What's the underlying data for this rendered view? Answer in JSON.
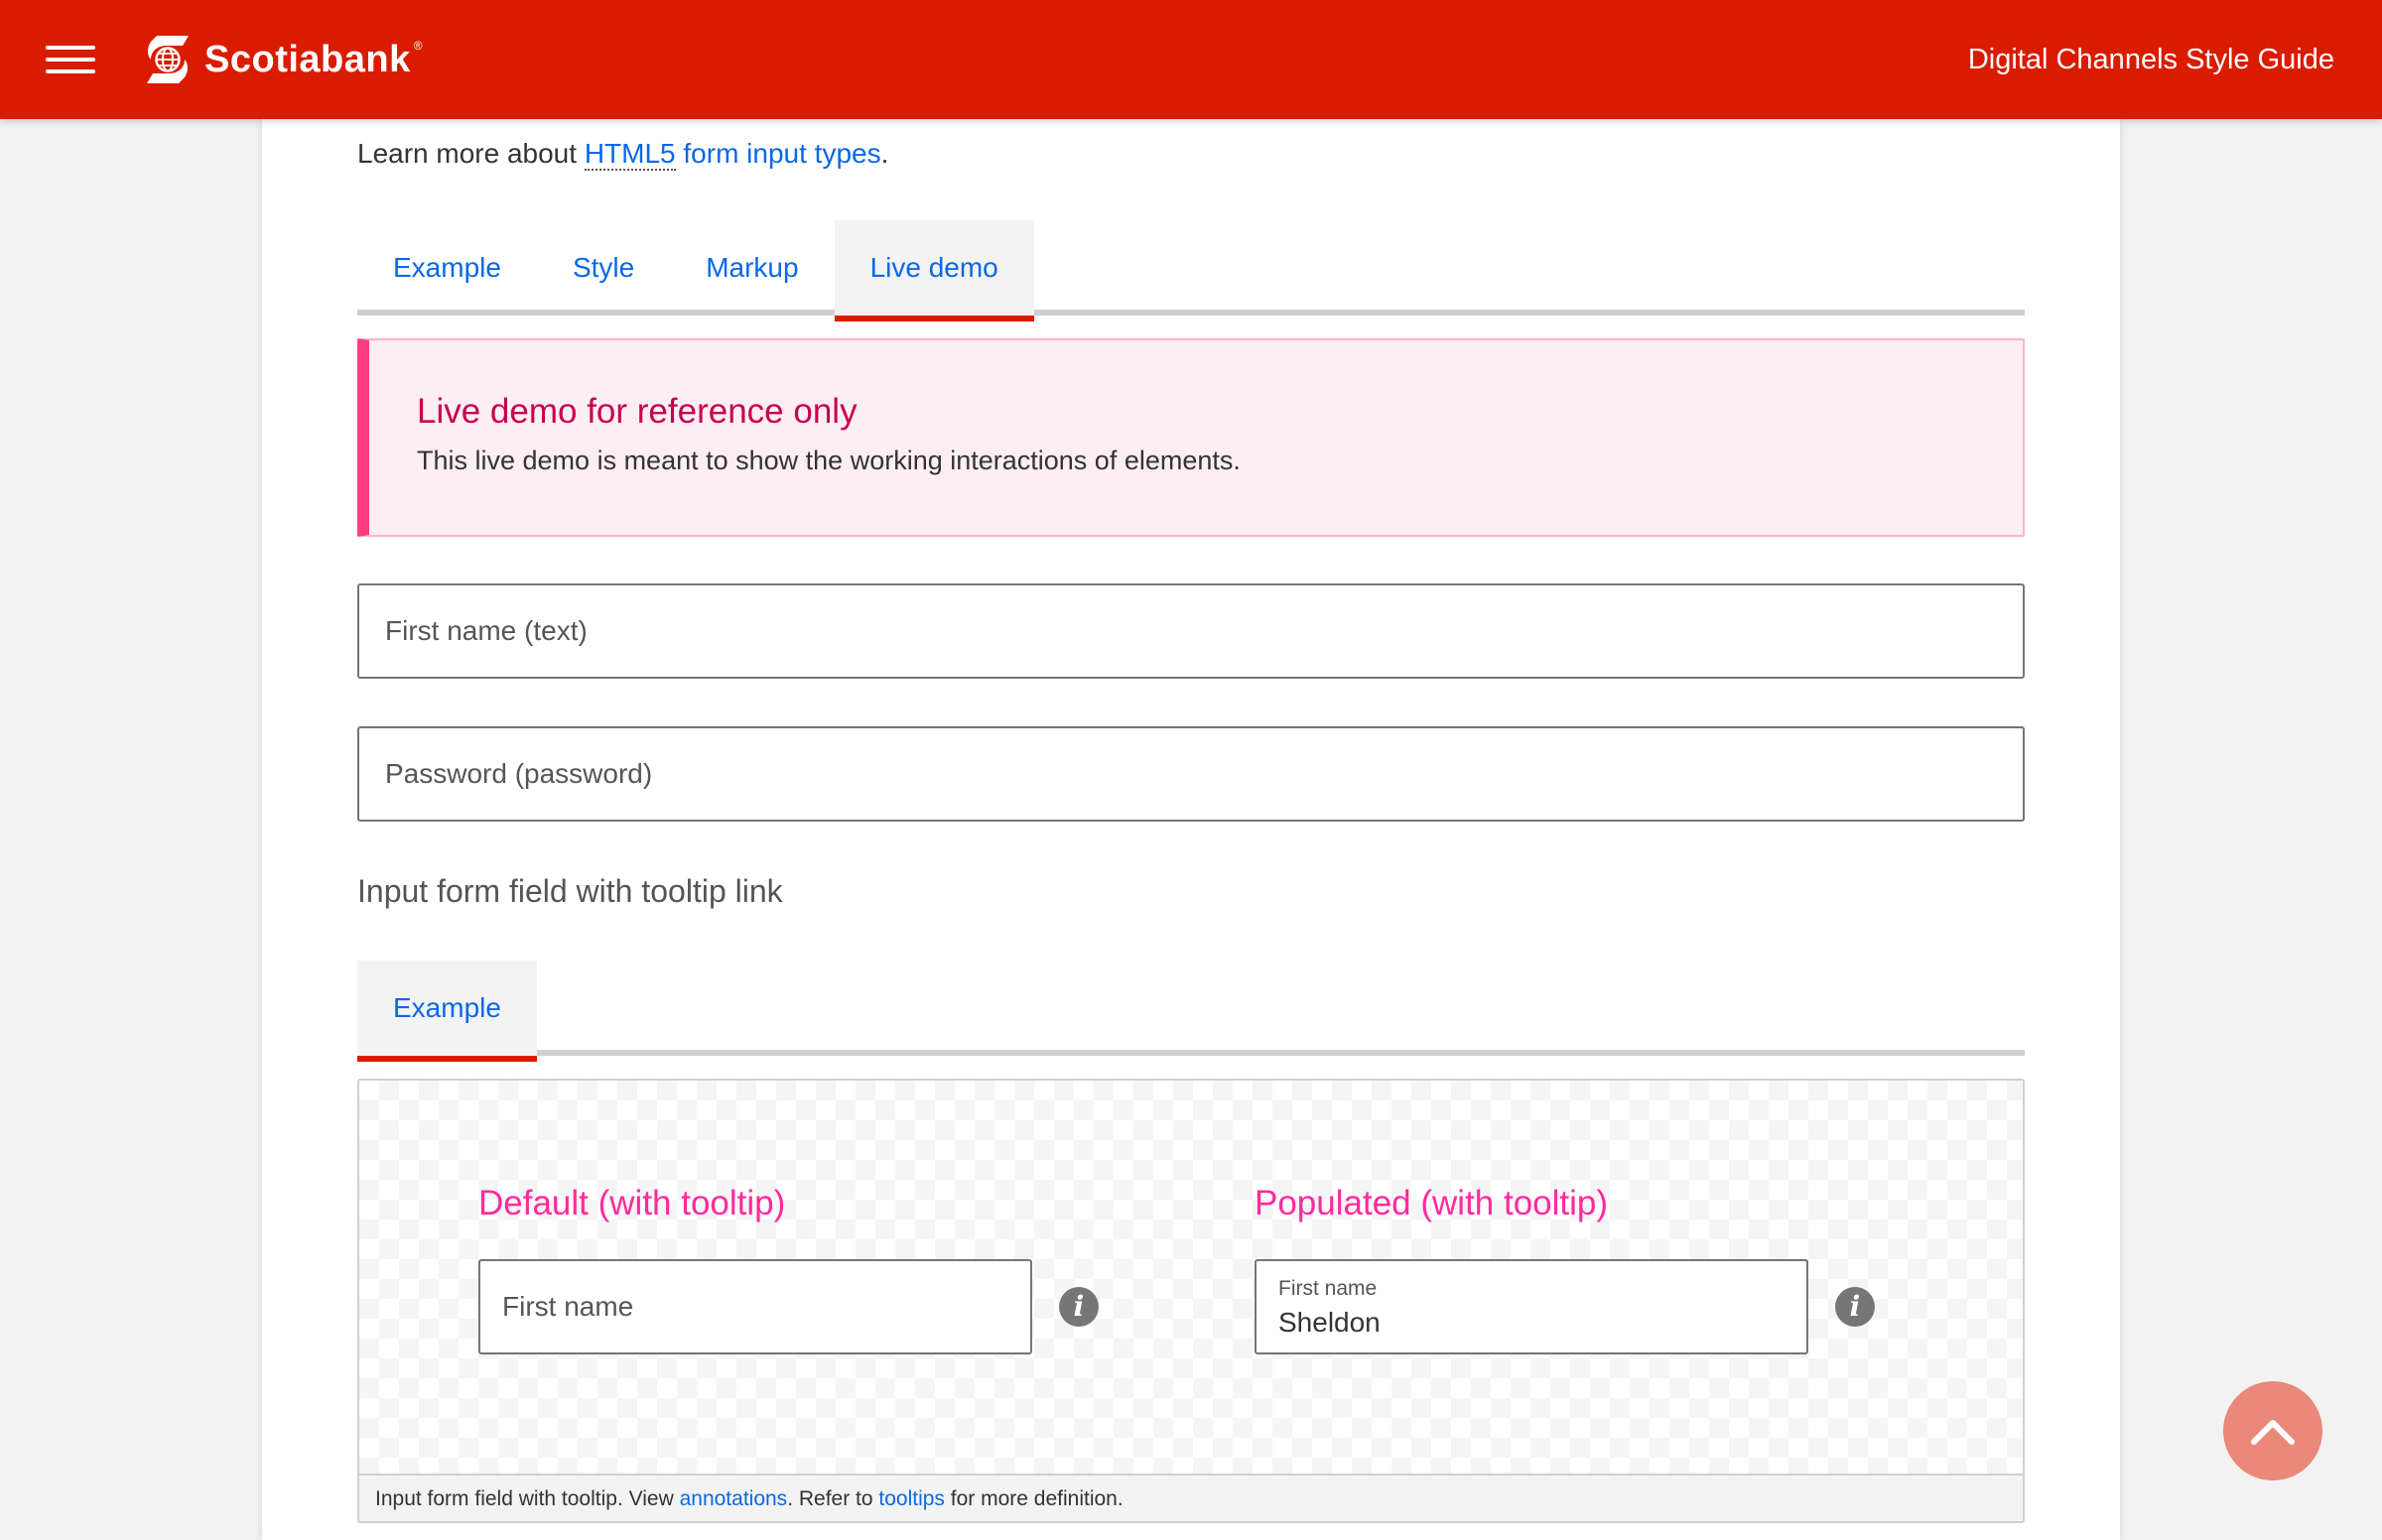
{
  "header": {
    "menu_icon": "hamburger-menu-icon",
    "brand": "Scotiabank",
    "brand_mark": "®",
    "title": "Digital Channels Style Guide",
    "color": "#d91c00"
  },
  "intro": {
    "prefix": "Learn more about ",
    "link_abbr": "HTML5",
    "link_rest": " form input types",
    "suffix": "."
  },
  "tabs_primary": [
    {
      "label": "Example",
      "active": false
    },
    {
      "label": "Style",
      "active": false
    },
    {
      "label": "Markup",
      "active": false
    },
    {
      "label": "Live demo",
      "active": true
    }
  ],
  "alert": {
    "title": "Live demo for reference only",
    "body": "This live demo is meant to show the working interactions of elements.",
    "accent": "#fc3d81"
  },
  "fields": [
    {
      "placeholder": "First name (text)",
      "type": "text"
    },
    {
      "placeholder": "Password (password)",
      "type": "password"
    }
  ],
  "section": {
    "heading": "Input form field with tooltip link"
  },
  "tabs_secondary": [
    {
      "label": "Example",
      "active": true
    }
  ],
  "demo": {
    "default": {
      "heading": "Default (with tooltip)",
      "placeholder": "First name",
      "icon": "info-icon"
    },
    "populated": {
      "heading": "Populated (with tooltip)",
      "label": "First name",
      "value": "Sheldon",
      "icon": "info-icon"
    },
    "caption": {
      "prefix": "Input form field with tooltip. View ",
      "link1": "annotations",
      "middle": ". Refer to ",
      "link2": "tooltips",
      "suffix": " for more definition."
    }
  },
  "back_to_top": {
    "icon": "chevron-up-icon",
    "color": "#ea887a"
  }
}
